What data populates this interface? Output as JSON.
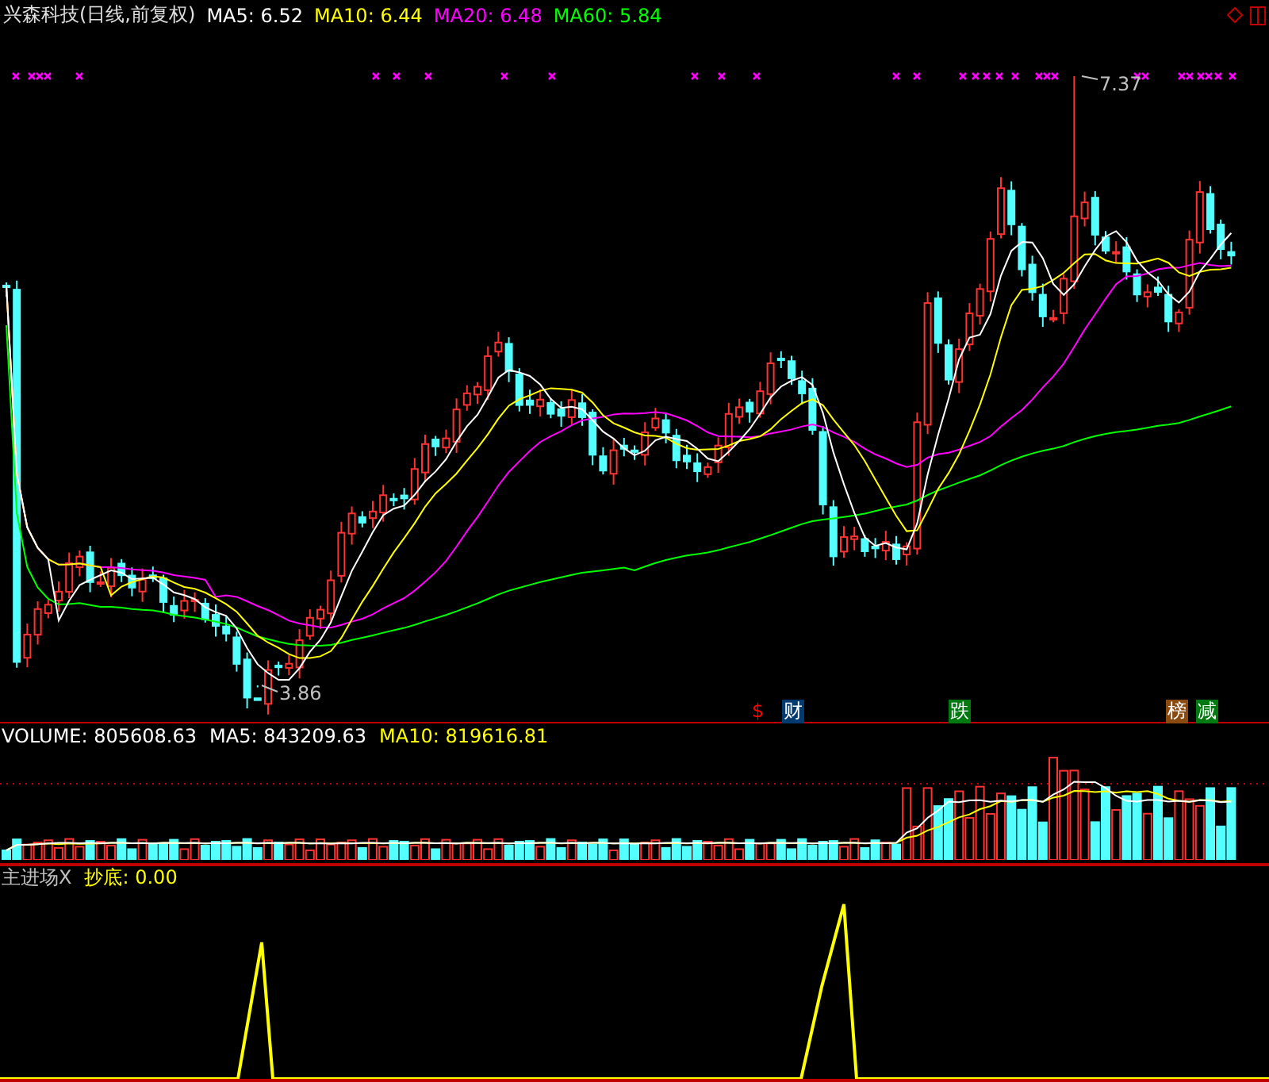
{
  "header": {
    "title": "兴森科技(日线,前复权)",
    "indicators": [
      {
        "label": "MA5:",
        "value": "6.52",
        "color": "#ffffff"
      },
      {
        "label": "MA10:",
        "value": "6.44",
        "color": "#ffff00"
      },
      {
        "label": "MA20:",
        "value": "6.48",
        "color": "#ff00ff"
      },
      {
        "label": "MA60:",
        "value": "5.84",
        "color": "#00ff00"
      }
    ]
  },
  "price_chart": {
    "high_label": "7.37",
    "low_label": "3.86"
  },
  "event_tags": [
    {
      "kind": "symbol",
      "text": "$",
      "color": "#ff0000"
    },
    {
      "kind": "tag",
      "text": "财",
      "color": "#003a6e"
    },
    {
      "kind": "tag",
      "text": "跌",
      "color": "#007a10"
    },
    {
      "kind": "tag",
      "text": "榜",
      "color": "#8a4a10"
    },
    {
      "kind": "tag",
      "text": "减",
      "color": "#007a10"
    }
  ],
  "volume": {
    "label": "VOLUME:",
    "value": "805608.63",
    "indicators": [
      {
        "label": "MA5:",
        "value": "843209.63",
        "color": "#ffffff"
      },
      {
        "label": "MA10:",
        "value": "819616.81",
        "color": "#ffff00"
      }
    ]
  },
  "indicator_panel": {
    "name": "主进场X",
    "label": "抄底:",
    "value": "0.00"
  }
}
